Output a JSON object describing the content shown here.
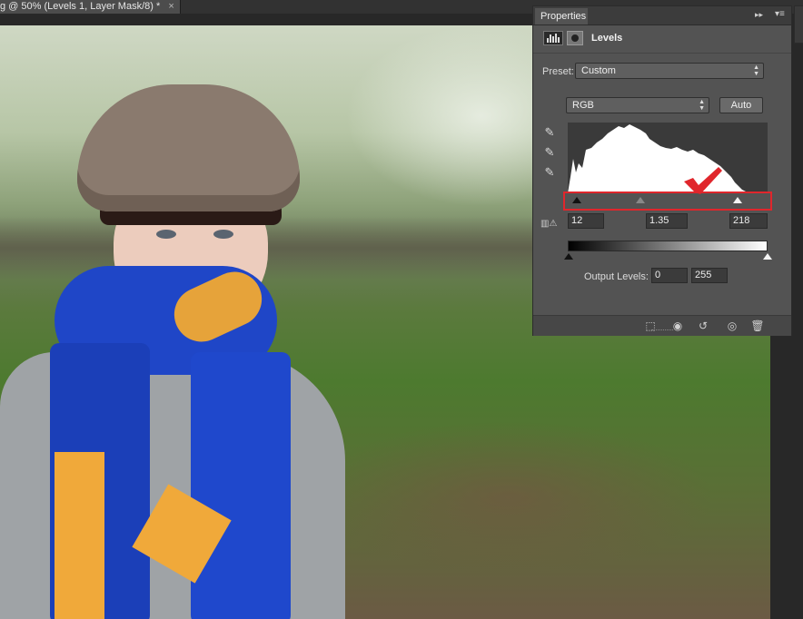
{
  "document": {
    "tab_title": "g @ 50% (Levels 1, Layer Mask/8) *",
    "close_glyph": "×"
  },
  "panel": {
    "tab_label": "Properties",
    "collapse_glyph": "▸▸",
    "menu_glyph": "▾≡",
    "adjustment_title": "Levels",
    "preset_label": "Preset:",
    "preset_value": "Custom",
    "channel_value": "RGB",
    "auto_label": "Auto",
    "input_black": "12",
    "input_gamma": "1.35",
    "input_white": "218",
    "output_label": "Output Levels:",
    "output_black": "0",
    "output_white": "255"
  },
  "icons": {
    "levels": "levels-histogram-icon",
    "mask": "layer-mask-icon",
    "eyedropper_black": "black-eyedropper-icon",
    "eyedropper_gray": "gray-eyedropper-icon",
    "eyedropper_white": "white-eyedropper-icon",
    "clipping_warning": "clipping-warning-icon",
    "footer": [
      "clip-to-layer-icon",
      "view-previous-state-icon",
      "reset-icon",
      "visibility-eye-icon",
      "trash-icon"
    ]
  },
  "annotation": {
    "highlight_color": "#e0262c"
  }
}
